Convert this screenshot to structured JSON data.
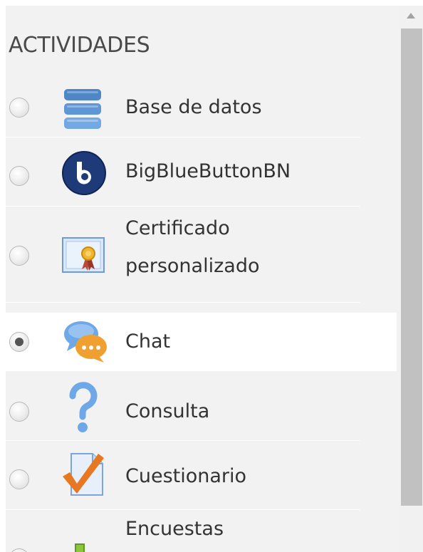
{
  "section": {
    "title": "ACTIVIDADES"
  },
  "activities": [
    {
      "label": "Base de datos",
      "icon": "database-icon",
      "selected": false
    },
    {
      "label": "BigBlueButtonBN",
      "icon": "bigbluebutton-icon",
      "selected": false
    },
    {
      "label_line1": "Certificado",
      "label_line2": "personalizado",
      "icon": "certificate-icon",
      "selected": false
    },
    {
      "label": "Chat",
      "icon": "chat-icon",
      "selected": true
    },
    {
      "label": "Consulta",
      "icon": "question-icon",
      "selected": false
    },
    {
      "label": "Cuestionario",
      "icon": "quiz-icon",
      "selected": false
    },
    {
      "label": "Encuestas",
      "icon": "survey-icon",
      "selected": false
    }
  ],
  "colors": {
    "accent_blue": "#5b9bd5",
    "chat_orange": "#f0a030",
    "quiz_orange": "#e87722",
    "scroll_thumb": "#c1c1c1"
  }
}
